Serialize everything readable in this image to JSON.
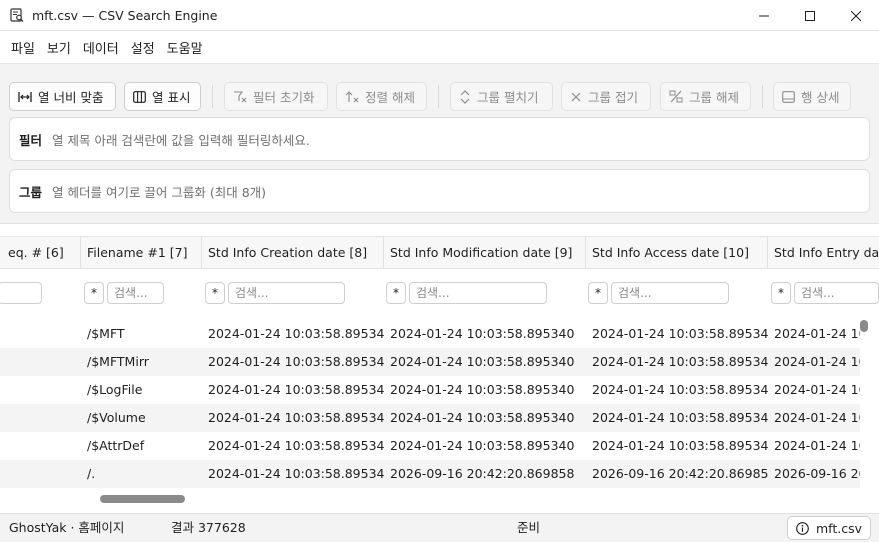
{
  "window": {
    "title": "mft.csv — CSV Search Engine",
    "icon": "app-search-doc-icon"
  },
  "menu": [
    {
      "label": "파일"
    },
    {
      "label": "보기"
    },
    {
      "label": "데이터"
    },
    {
      "label": "설정"
    },
    {
      "label": "도움말"
    }
  ],
  "toolbar": {
    "fit_width": {
      "label": "열 너비 맞춤",
      "icon": "fit-width-icon",
      "enabled": true
    },
    "show_columns": {
      "label": "열 표시",
      "icon": "columns-icon",
      "enabled": true
    },
    "reset_filters": {
      "label": "필터 초기화",
      "icon": "filter-clear-icon",
      "enabled": false
    },
    "clear_sort": {
      "label": "정렬 해제",
      "icon": "sort-clear-icon",
      "enabled": false
    },
    "expand_groups": {
      "label": "그룹 펼치기",
      "icon": "expand-icon",
      "enabled": false
    },
    "collapse_groups": {
      "label": "그룹 접기",
      "icon": "collapse-icon",
      "enabled": false
    },
    "ungroup": {
      "label": "그룹 해제",
      "icon": "ungroup-icon",
      "enabled": false
    },
    "row_detail": {
      "label": "행 상세",
      "icon": "row-detail-icon",
      "enabled": false
    }
  },
  "filter_panel": {
    "label": "필터",
    "hint": "열 제목 아래 검색란에 값을 입력해 필터링하세요."
  },
  "group_panel": {
    "label": "그룹",
    "hint": "열 헤더를 여기로 끌어 그룹화 (최대 8개)"
  },
  "table": {
    "columns": [
      "eq. # [6]",
      "Filename #1 [7]",
      "Std Info Creation date [8]",
      "Std Info Modification date [9]",
      "Std Info Access date [10]",
      "Std Info Entry da"
    ],
    "filter_star": "*",
    "search_placeholder": "검색...",
    "rows": [
      [
        "",
        "/$MFT",
        "2024-01-24 10:03:58.895340",
        "2024-01-24 10:03:58.895340",
        "2024-01-24 10:03:58.895340",
        "2024-01-24 10"
      ],
      [
        "",
        "/$MFTMirr",
        "2024-01-24 10:03:58.895340",
        "2024-01-24 10:03:58.895340",
        "2024-01-24 10:03:58.895340",
        "2024-01-24 10"
      ],
      [
        "",
        "/$LogFile",
        "2024-01-24 10:03:58.895340",
        "2024-01-24 10:03:58.895340",
        "2024-01-24 10:03:58.895340",
        "2024-01-24 10"
      ],
      [
        "",
        "/$Volume",
        "2024-01-24 10:03:58.895340",
        "2024-01-24 10:03:58.895340",
        "2024-01-24 10:03:58.895340",
        "2024-01-24 10"
      ],
      [
        "",
        "/$AttrDef",
        "2024-01-24 10:03:58.895340",
        "2024-01-24 10:03:58.895340",
        "2024-01-24 10:03:58.895340",
        "2024-01-24 10"
      ],
      [
        "",
        "/.",
        "2024-01-24 10:03:58.895340",
        "2026-09-16 20:42:20.869858",
        "2026-09-16 20:42:20.869858",
        "2026-09-16 20"
      ]
    ]
  },
  "statusbar": {
    "author": "GhostYak · 홈페이지",
    "results": "결과 377628",
    "state": "준비",
    "file": "mft.csv",
    "file_icon": "info-icon"
  }
}
